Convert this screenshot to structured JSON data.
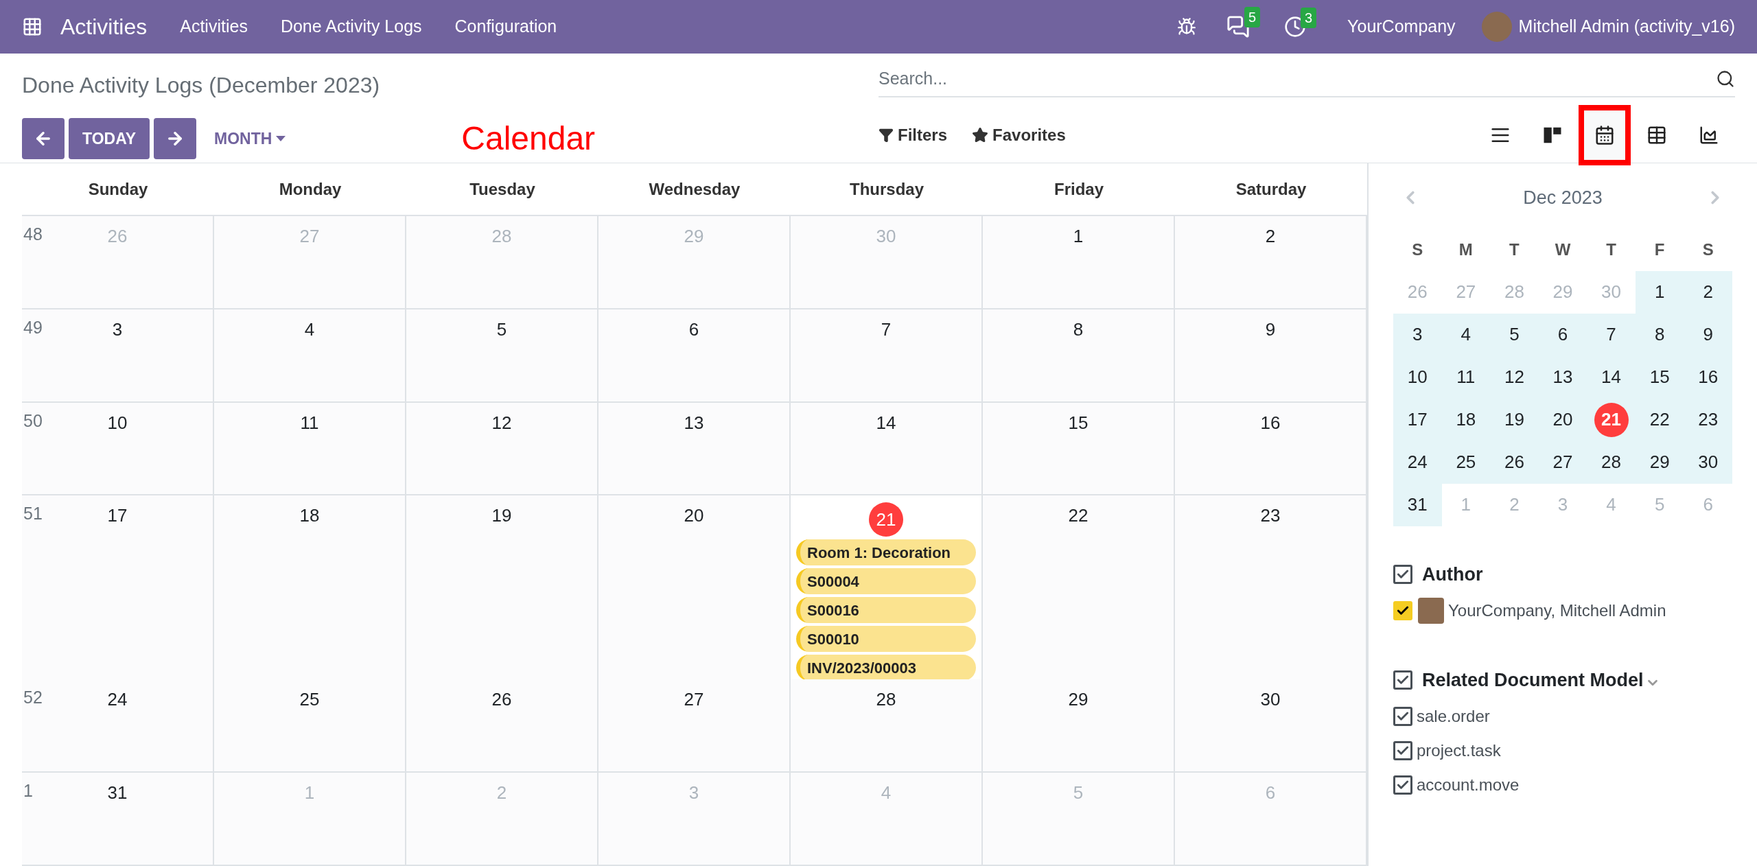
{
  "navbar": {
    "app": "Activities",
    "menu": [
      "Activities",
      "Done Activity Logs",
      "Configuration"
    ],
    "messages_badge": "5",
    "activities_badge": "3",
    "company": "YourCompany",
    "user": "Mitchell Admin (activity_v16)"
  },
  "control_panel": {
    "title": "Done Activity Logs (December 2023)",
    "today": "TODAY",
    "scale": "MONTH",
    "annotation": "Calendar",
    "search": {
      "placeholder": "Search..."
    },
    "filters": "Filters",
    "favorites": "Favorites",
    "views": [
      {
        "kind": "list",
        "selected": false
      },
      {
        "kind": "kanban",
        "selected": false
      },
      {
        "kind": "calendar",
        "selected": true
      },
      {
        "kind": "pivot",
        "selected": false
      },
      {
        "kind": "graph",
        "selected": false
      }
    ]
  },
  "calendar": {
    "weekdays": [
      "Sunday",
      "Monday",
      "Tuesday",
      "Wednesday",
      "Thursday",
      "Friday",
      "Saturday"
    ],
    "weeks": [
      {
        "number": "48",
        "days": [
          {
            "label": "26",
            "muted": true,
            "today": false
          },
          {
            "label": "27",
            "muted": true,
            "today": false
          },
          {
            "label": "28",
            "muted": true,
            "today": false
          },
          {
            "label": "29",
            "muted": true,
            "today": false
          },
          {
            "label": "30",
            "muted": true,
            "today": false
          },
          {
            "label": "1",
            "muted": false,
            "today": false
          },
          {
            "label": "2",
            "muted": false,
            "today": false
          }
        ]
      },
      {
        "number": "49",
        "days": [
          {
            "label": "3",
            "muted": false,
            "today": false
          },
          {
            "label": "4",
            "muted": false,
            "today": false
          },
          {
            "label": "5",
            "muted": false,
            "today": false
          },
          {
            "label": "6",
            "muted": false,
            "today": false
          },
          {
            "label": "7",
            "muted": false,
            "today": false
          },
          {
            "label": "8",
            "muted": false,
            "today": false
          },
          {
            "label": "9",
            "muted": false,
            "today": false
          }
        ]
      },
      {
        "number": "50",
        "days": [
          {
            "label": "10",
            "muted": false,
            "today": false
          },
          {
            "label": "11",
            "muted": false,
            "today": false
          },
          {
            "label": "12",
            "muted": false,
            "today": false
          },
          {
            "label": "13",
            "muted": false,
            "today": false
          },
          {
            "label": "14",
            "muted": false,
            "today": false
          },
          {
            "label": "15",
            "muted": false,
            "today": false
          },
          {
            "label": "16",
            "muted": false,
            "today": false
          }
        ]
      },
      {
        "number": "51",
        "days": [
          {
            "label": "17",
            "muted": false,
            "today": false
          },
          {
            "label": "18",
            "muted": false,
            "today": false
          },
          {
            "label": "19",
            "muted": false,
            "today": false
          },
          {
            "label": "20",
            "muted": false,
            "today": false
          },
          {
            "label": "21",
            "muted": false,
            "today": true,
            "events": [
              "Room 1: Decoration",
              "S00004",
              "S00016",
              "S00010",
              "INV/2023/00003"
            ]
          },
          {
            "label": "22",
            "muted": false,
            "today": false
          },
          {
            "label": "23",
            "muted": false,
            "today": false
          }
        ]
      },
      {
        "number": "52",
        "days": [
          {
            "label": "24",
            "muted": false,
            "today": false
          },
          {
            "label": "25",
            "muted": false,
            "today": false
          },
          {
            "label": "26",
            "muted": false,
            "today": false
          },
          {
            "label": "27",
            "muted": false,
            "today": false
          },
          {
            "label": "28",
            "muted": false,
            "today": false
          },
          {
            "label": "29",
            "muted": false,
            "today": false
          },
          {
            "label": "30",
            "muted": false,
            "today": false
          }
        ]
      },
      {
        "number": "1",
        "days": [
          {
            "label": "31",
            "muted": false,
            "today": false
          },
          {
            "label": "1",
            "muted": true,
            "today": false
          },
          {
            "label": "2",
            "muted": true,
            "today": false
          },
          {
            "label": "3",
            "muted": true,
            "today": false
          },
          {
            "label": "4",
            "muted": true,
            "today": false
          },
          {
            "label": "5",
            "muted": true,
            "today": false
          },
          {
            "label": "6",
            "muted": true,
            "today": false
          }
        ]
      }
    ]
  },
  "sidebar": {
    "mini_calendar": {
      "title": "Dec 2023",
      "weekdays": [
        "S",
        "M",
        "T",
        "W",
        "T",
        "F",
        "S"
      ],
      "days": [
        {
          "label": "26",
          "muted": true,
          "today": false
        },
        {
          "label": "27",
          "muted": true,
          "today": false
        },
        {
          "label": "28",
          "muted": true,
          "today": false
        },
        {
          "label": "29",
          "muted": true,
          "today": false
        },
        {
          "label": "30",
          "muted": true,
          "today": false
        },
        {
          "label": "1",
          "muted": false,
          "today": false
        },
        {
          "label": "2",
          "muted": false,
          "today": false
        },
        {
          "label": "3",
          "muted": false,
          "today": false
        },
        {
          "label": "4",
          "muted": false,
          "today": false
        },
        {
          "label": "5",
          "muted": false,
          "today": false
        },
        {
          "label": "6",
          "muted": false,
          "today": false
        },
        {
          "label": "7",
          "muted": false,
          "today": false
        },
        {
          "label": "8",
          "muted": false,
          "today": false
        },
        {
          "label": "9",
          "muted": false,
          "today": false
        },
        {
          "label": "10",
          "muted": false,
          "today": false
        },
        {
          "label": "11",
          "muted": false,
          "today": false
        },
        {
          "label": "12",
          "muted": false,
          "today": false
        },
        {
          "label": "13",
          "muted": false,
          "today": false
        },
        {
          "label": "14",
          "muted": false,
          "today": false
        },
        {
          "label": "15",
          "muted": false,
          "today": false
        },
        {
          "label": "16",
          "muted": false,
          "today": false
        },
        {
          "label": "17",
          "muted": false,
          "today": false
        },
        {
          "label": "18",
          "muted": false,
          "today": false
        },
        {
          "label": "19",
          "muted": false,
          "today": false
        },
        {
          "label": "20",
          "muted": false,
          "today": false
        },
        {
          "label": "21",
          "muted": false,
          "today": true
        },
        {
          "label": "22",
          "muted": false,
          "today": false
        },
        {
          "label": "23",
          "muted": false,
          "today": false
        },
        {
          "label": "24",
          "muted": false,
          "today": false
        },
        {
          "label": "25",
          "muted": false,
          "today": false
        },
        {
          "label": "26",
          "muted": false,
          "today": false
        },
        {
          "label": "27",
          "muted": false,
          "today": false
        },
        {
          "label": "28",
          "muted": false,
          "today": false
        },
        {
          "label": "29",
          "muted": false,
          "today": false
        },
        {
          "label": "30",
          "muted": false,
          "today": false
        },
        {
          "label": "31",
          "muted": false,
          "today": false
        },
        {
          "label": "1",
          "muted": true,
          "today": false
        },
        {
          "label": "2",
          "muted": true,
          "today": false
        },
        {
          "label": "3",
          "muted": true,
          "today": false
        },
        {
          "label": "4",
          "muted": true,
          "today": false
        },
        {
          "label": "5",
          "muted": true,
          "today": false
        },
        {
          "label": "6",
          "muted": true,
          "today": false
        }
      ]
    },
    "filters": [
      {
        "title": "Author",
        "checked": true,
        "collapsible": false,
        "items": [
          {
            "label": "YourCompany, Mitchell Admin",
            "checked": true,
            "avatar": true,
            "color": "#f5cd22"
          }
        ]
      },
      {
        "title": "Related Document Model",
        "checked": true,
        "collapsible": true,
        "items": [
          {
            "label": "sale.order",
            "checked": true,
            "avatar": false
          },
          {
            "label": "project.task",
            "checked": true,
            "avatar": false
          },
          {
            "label": "account.move",
            "checked": true,
            "avatar": false
          }
        ]
      }
    ]
  }
}
